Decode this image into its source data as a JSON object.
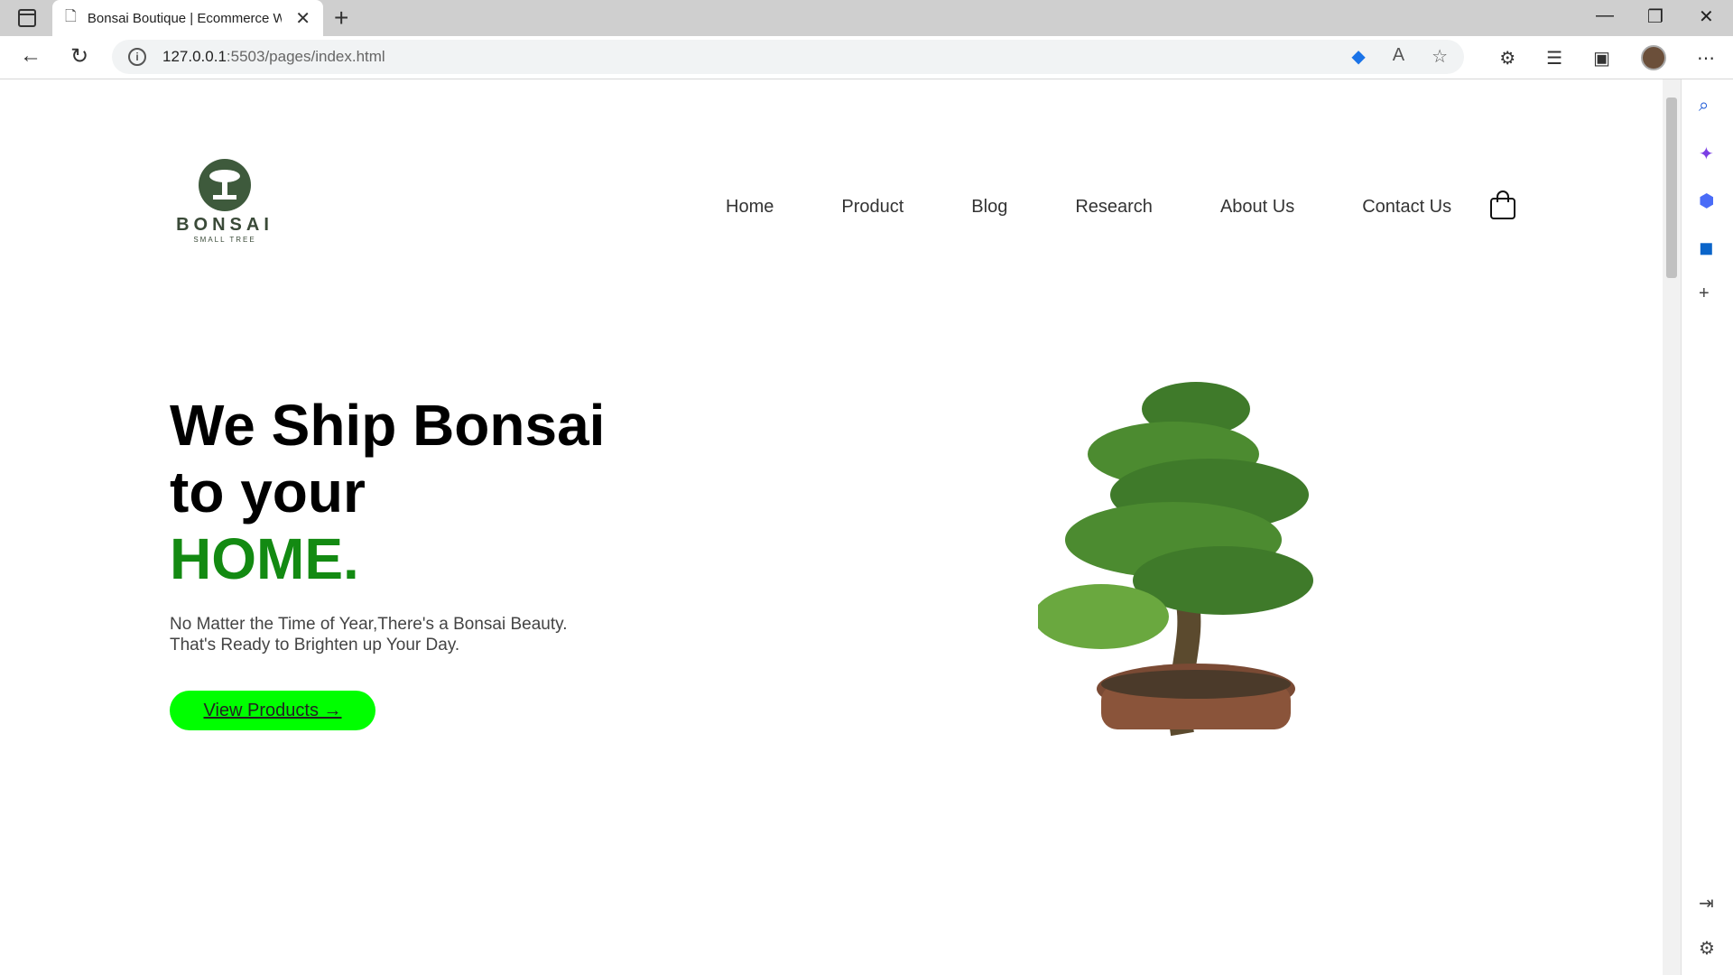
{
  "browser": {
    "tab_title": "Bonsai Boutique | Ecommerce W",
    "url_host": "127.0.0.1",
    "url_path": ":5503/pages/index.html"
  },
  "brand": {
    "name": "BONSAI",
    "tagline": "SMALL TREE"
  },
  "nav": {
    "items": [
      "Home",
      "Product",
      "Blog",
      "Research",
      "About Us",
      "Contact Us"
    ]
  },
  "hero": {
    "line1": "We Ship Bonsai",
    "line2": "to your",
    "accent": "HOME.",
    "sub1": "No Matter the Time of Year,There's a Bonsai Beauty.",
    "sub2": "That's Ready to Brighten up Your Day.",
    "cta": "View Products →"
  },
  "colors": {
    "accent_green": "#138a12",
    "cta_green": "#00ff00",
    "brand_dark": "#3e5a3c"
  }
}
